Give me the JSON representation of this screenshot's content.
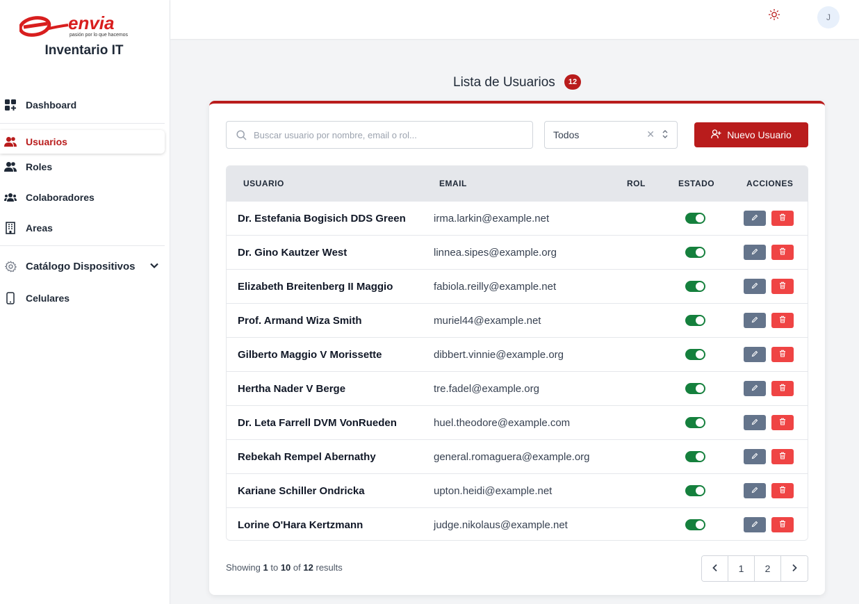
{
  "app": {
    "brand": "envia",
    "tagline": "pasión por lo que hacemos",
    "title": "Inventario IT",
    "colors": {
      "accent": "#b91c1c",
      "success": "#15803d",
      "danger": "#ef4444",
      "muted": "#64748b"
    }
  },
  "sidebar": {
    "items": [
      {
        "label": "Dashboard",
        "icon": "grid-plus-icon"
      },
      {
        "label": "Usuarios",
        "icon": "users-icon",
        "active": true
      },
      {
        "label": "Roles",
        "icon": "users-icon"
      },
      {
        "label": "Colaboradores",
        "icon": "team-icon"
      },
      {
        "label": "Areas",
        "icon": "building-icon"
      },
      {
        "label": "Catálogo Dispositivos",
        "icon": "gear-icon",
        "expandable": true
      },
      {
        "label": "Celulares",
        "icon": "phone-icon"
      }
    ]
  },
  "topbar": {
    "theme_icon": "sun-icon",
    "avatar_initial": "J"
  },
  "page": {
    "title": "Lista de Usuarios",
    "count": "12"
  },
  "toolbar": {
    "search_placeholder": "Buscar usuario por nombre, email o rol...",
    "filter_value": "Todos",
    "new_button": "Nuevo Usuario"
  },
  "table": {
    "headers": {
      "user": "USUARIO",
      "email": "EMAIL",
      "role": "ROL",
      "status": "ESTADO",
      "actions": "ACCIONES"
    },
    "rows": [
      {
        "name": "Dr. Estefania Bogisich DDS Green",
        "email": "irma.larkin@example.net",
        "active": true
      },
      {
        "name": "Dr. Gino Kautzer West",
        "email": "linnea.sipes@example.org",
        "active": true
      },
      {
        "name": "Elizabeth Breitenberg II Maggio",
        "email": "fabiola.reilly@example.net",
        "active": true
      },
      {
        "name": "Prof. Armand Wiza Smith",
        "email": "muriel44@example.net",
        "active": true
      },
      {
        "name": "Gilberto Maggio V Morissette",
        "email": "dibbert.vinnie@example.org",
        "active": true
      },
      {
        "name": "Hertha Nader V Berge",
        "email": "tre.fadel@example.org",
        "active": true
      },
      {
        "name": "Dr. Leta Farrell DVM VonRueden",
        "email": "huel.theodore@example.com",
        "active": true
      },
      {
        "name": "Rebekah Rempel Abernathy",
        "email": "general.romaguera@example.org",
        "active": true
      },
      {
        "name": "Kariane Schiller Ondricka",
        "email": "upton.heidi@example.net",
        "active": true
      },
      {
        "name": "Lorine O'Hara Kertzmann",
        "email": "judge.nikolaus@example.net",
        "active": true
      }
    ]
  },
  "pagination": {
    "showing_prefix": "Showing",
    "from": "1",
    "to_word": "to",
    "to": "10",
    "of_word": "of",
    "total": "12",
    "results_word": "results",
    "pages": [
      "1",
      "2"
    ]
  }
}
